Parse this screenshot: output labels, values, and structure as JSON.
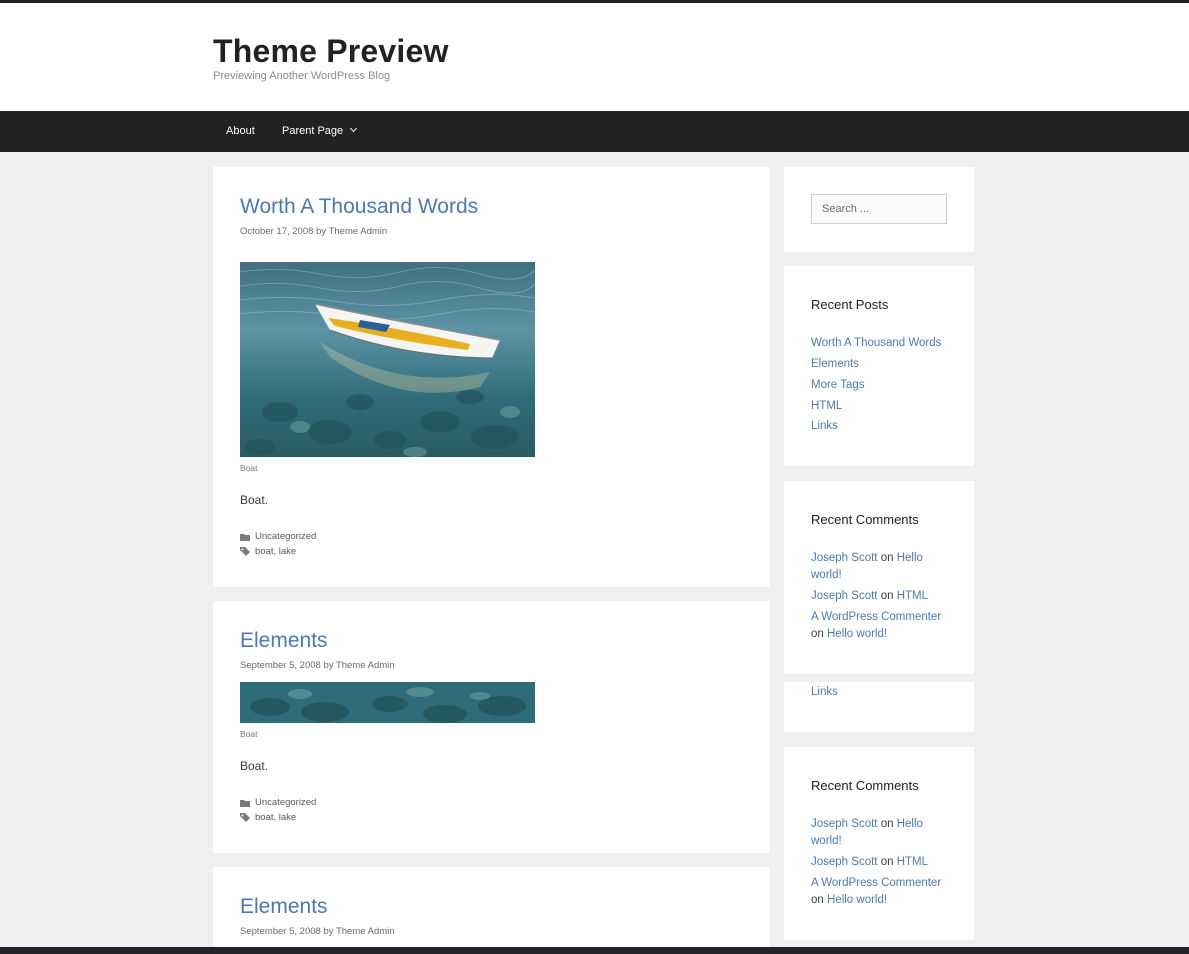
{
  "site": {
    "title": "Theme Preview",
    "tagline": "Previewing Another WordPress Blog"
  },
  "nav": {
    "items": [
      {
        "label": "About"
      },
      {
        "label": "Parent Page"
      }
    ]
  },
  "posts": [
    {
      "title": "Worth A Thousand Words",
      "date": "October 17, 2008",
      "by": "by",
      "author": "Theme Admin",
      "caption": "Boat",
      "excerpt": "Boat.",
      "category": "Uncategorized",
      "tags": "boat, lake"
    },
    {
      "title": "Elements",
      "date": "September 5, 2008",
      "by": "by",
      "author": "Theme Admin",
      "caption": "Boat",
      "excerpt": "Boat.",
      "category": "Uncategorized",
      "tags": "boat, lake"
    },
    {
      "title": "Elements",
      "date": "September 5, 2008",
      "by": "by",
      "author": "Theme Admin"
    }
  ],
  "sidebar": {
    "search_placeholder": "Search ...",
    "recent_posts": {
      "title": "Recent Posts",
      "items": [
        "Worth A Thousand Words",
        "Elements",
        "More Tags",
        "HTML",
        "Links"
      ]
    },
    "recent_comments_1": {
      "title": "Recent Comments",
      "c1_author": "Joseph Scott",
      "c1_on": "on",
      "c1_post_a": "Hello",
      "c1_post_b": "world!",
      "c2_author": "Joseph Scott",
      "c2_on": "on",
      "c2_post": "HTML",
      "c3_author": "A WordPress Commenter",
      "c3_on": "on",
      "c3_post": "Hello world!"
    },
    "links_widget": {
      "link": "Links"
    },
    "recent_comments_2": {
      "title": "Recent Comments",
      "c1_author": "Joseph Scott",
      "c1_on": "on",
      "c1_post_a": "Hello",
      "c1_post_b": "world!",
      "c2_author": "Joseph Scott",
      "c2_on": "on",
      "c2_post": "HTML",
      "c3_author": "A WordPress Commenter",
      "c3_on": "on",
      "c3_post": "Hello world!"
    }
  },
  "icons": {
    "category": "folder-icon",
    "tags": "tag-icon",
    "dropdown": "chevron-down-icon"
  },
  "colors": {
    "link": "#4b79b6",
    "nav_bg": "#222222",
    "page_bg": "#efefef"
  }
}
